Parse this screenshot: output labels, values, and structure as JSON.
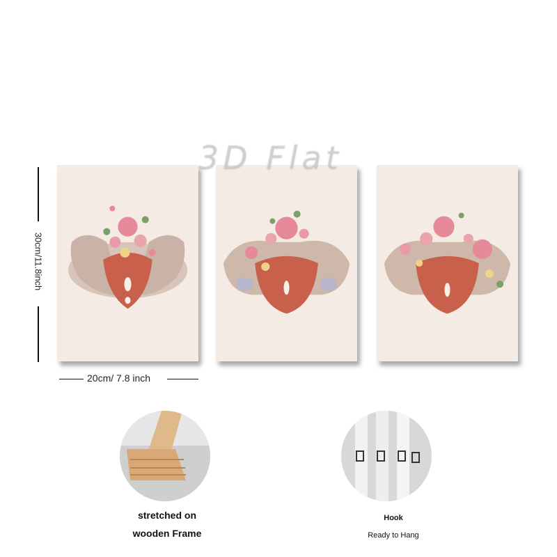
{
  "watermark": "3D Flat",
  "dimensions": {
    "height": "30cm/11.8inch",
    "width": "20cm/ 7.8 inch"
  },
  "features": [
    {
      "lines": [
        "stretched on",
        "wooden Frame"
      ]
    },
    {
      "lines": [
        "Hook",
        "Ready to Hang"
      ]
    }
  ],
  "colors": {
    "canvas": "#f4ece4",
    "bone": "#cdb8aa",
    "muscle": "#c8604b",
    "flower": "#e68a9a",
    "leaf": "#7da06a"
  }
}
